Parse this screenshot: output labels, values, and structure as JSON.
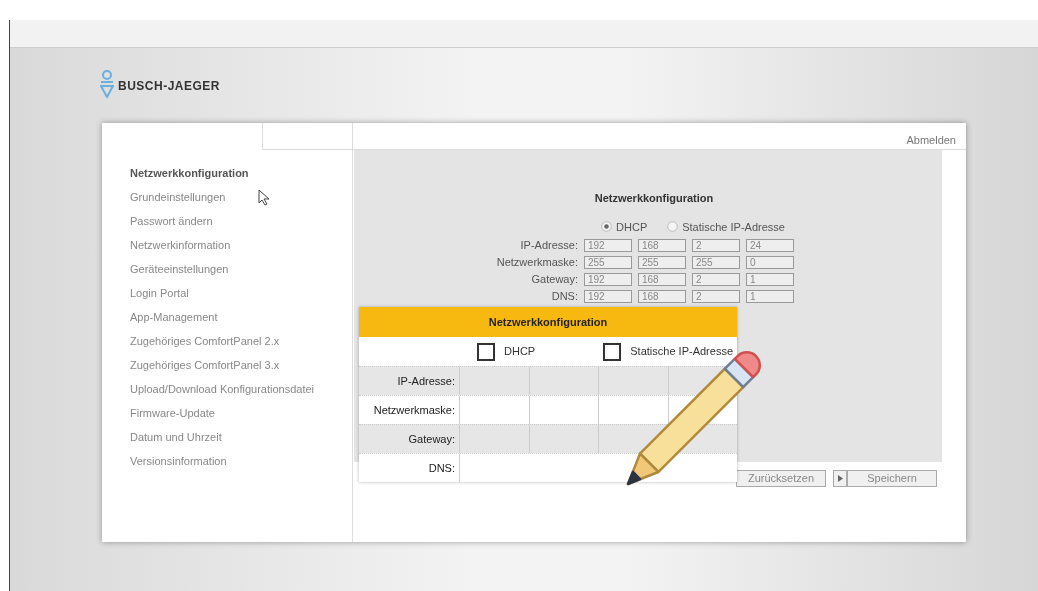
{
  "logo": {
    "text": "BUSCH-JAEGER"
  },
  "sidebar": {
    "items": [
      {
        "label": "Netzwerkkonfiguration",
        "selected": true
      },
      {
        "label": "Grundeinstellungen",
        "selected": false
      },
      {
        "label": "Passwort ändern",
        "selected": false
      },
      {
        "label": "Netzwerkinformation",
        "selected": false
      },
      {
        "label": "Geräteeinstellungen",
        "selected": false
      },
      {
        "label": "Login Portal",
        "selected": false
      },
      {
        "label": "App-Management",
        "selected": false
      },
      {
        "label": "Zugehöriges ComfortPanel 2.x",
        "selected": false
      },
      {
        "label": "Zugehöriges ComfortPanel 3.x",
        "selected": false
      },
      {
        "label": "Upload/Download Konfigurationsdatei",
        "selected": false
      },
      {
        "label": "Firmware-Update",
        "selected": false
      },
      {
        "label": "Datum und Uhrzeit",
        "selected": false
      },
      {
        "label": "Versionsinformation",
        "selected": false
      }
    ]
  },
  "header": {
    "logout": "Abmelden"
  },
  "panel": {
    "title": "Netzwerkkonfiguration",
    "modes": [
      {
        "label": "DHCP",
        "selected": true
      },
      {
        "label": "Statische IP-Adresse",
        "selected": false
      }
    ],
    "fields": [
      {
        "label": "IP-Adresse:",
        "values": [
          "192",
          "168",
          "2",
          "24"
        ]
      },
      {
        "label": "Netzwerkmaske:",
        "values": [
          "255",
          "255",
          "255",
          "0"
        ]
      },
      {
        "label": "Gateway:",
        "values": [
          "192",
          "168",
          "2",
          "1"
        ]
      },
      {
        "label": "DNS:",
        "values": [
          "192",
          "168",
          "2",
          "1"
        ]
      }
    ]
  },
  "buttons": [
    {
      "label": "Zurücksetzen",
      "kind": "plain"
    },
    {
      "label": "Speichern",
      "kind": "arrow"
    }
  ],
  "overlay": {
    "title": "Netzwerkkonfiguration",
    "options": [
      {
        "label": "DHCP",
        "checked": false
      },
      {
        "label": "Statische IP-Adresse",
        "checked": false
      }
    ],
    "rows": [
      "IP-Adresse:",
      "Netzwerkmaske:",
      "Gateway:",
      "DNS:"
    ]
  }
}
